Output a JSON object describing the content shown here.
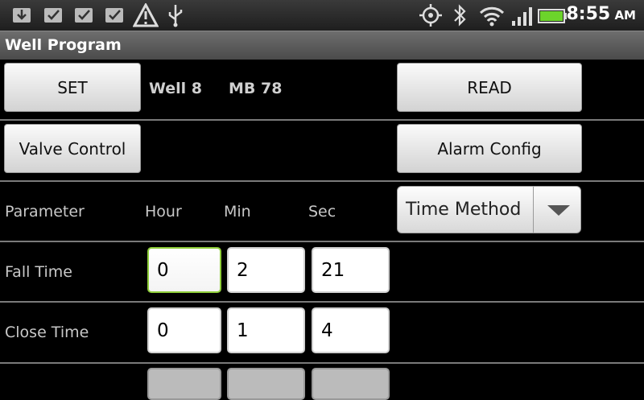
{
  "status_bar": {
    "icons": [
      "download-icon",
      "check-icon",
      "check-icon",
      "check-icon",
      "warning-icon",
      "usb-icon",
      "gps-icon",
      "bluetooth-icon",
      "wifi-icon",
      "signal-icon",
      "battery-icon"
    ],
    "time": "8:55",
    "ampm": "AM"
  },
  "app": {
    "title": "Well Program"
  },
  "row1": {
    "set_label": "SET",
    "well": "Well 8",
    "mb": "MB 78",
    "read_label": "READ"
  },
  "row2": {
    "valve_label": "Valve Control",
    "alarm_label": "Alarm Config"
  },
  "header": {
    "parameter": "Parameter",
    "hour": "Hour",
    "min": "Min",
    "sec": "Sec",
    "method": "Time Method"
  },
  "rows": [
    {
      "label": "Fall Time",
      "hour": "0",
      "min": "2",
      "sec": "21"
    },
    {
      "label": "Close Time",
      "hour": "0",
      "min": "1",
      "sec": "4"
    }
  ],
  "colors": {
    "focus": "#8fce3a",
    "battery": "#6cd42b"
  }
}
